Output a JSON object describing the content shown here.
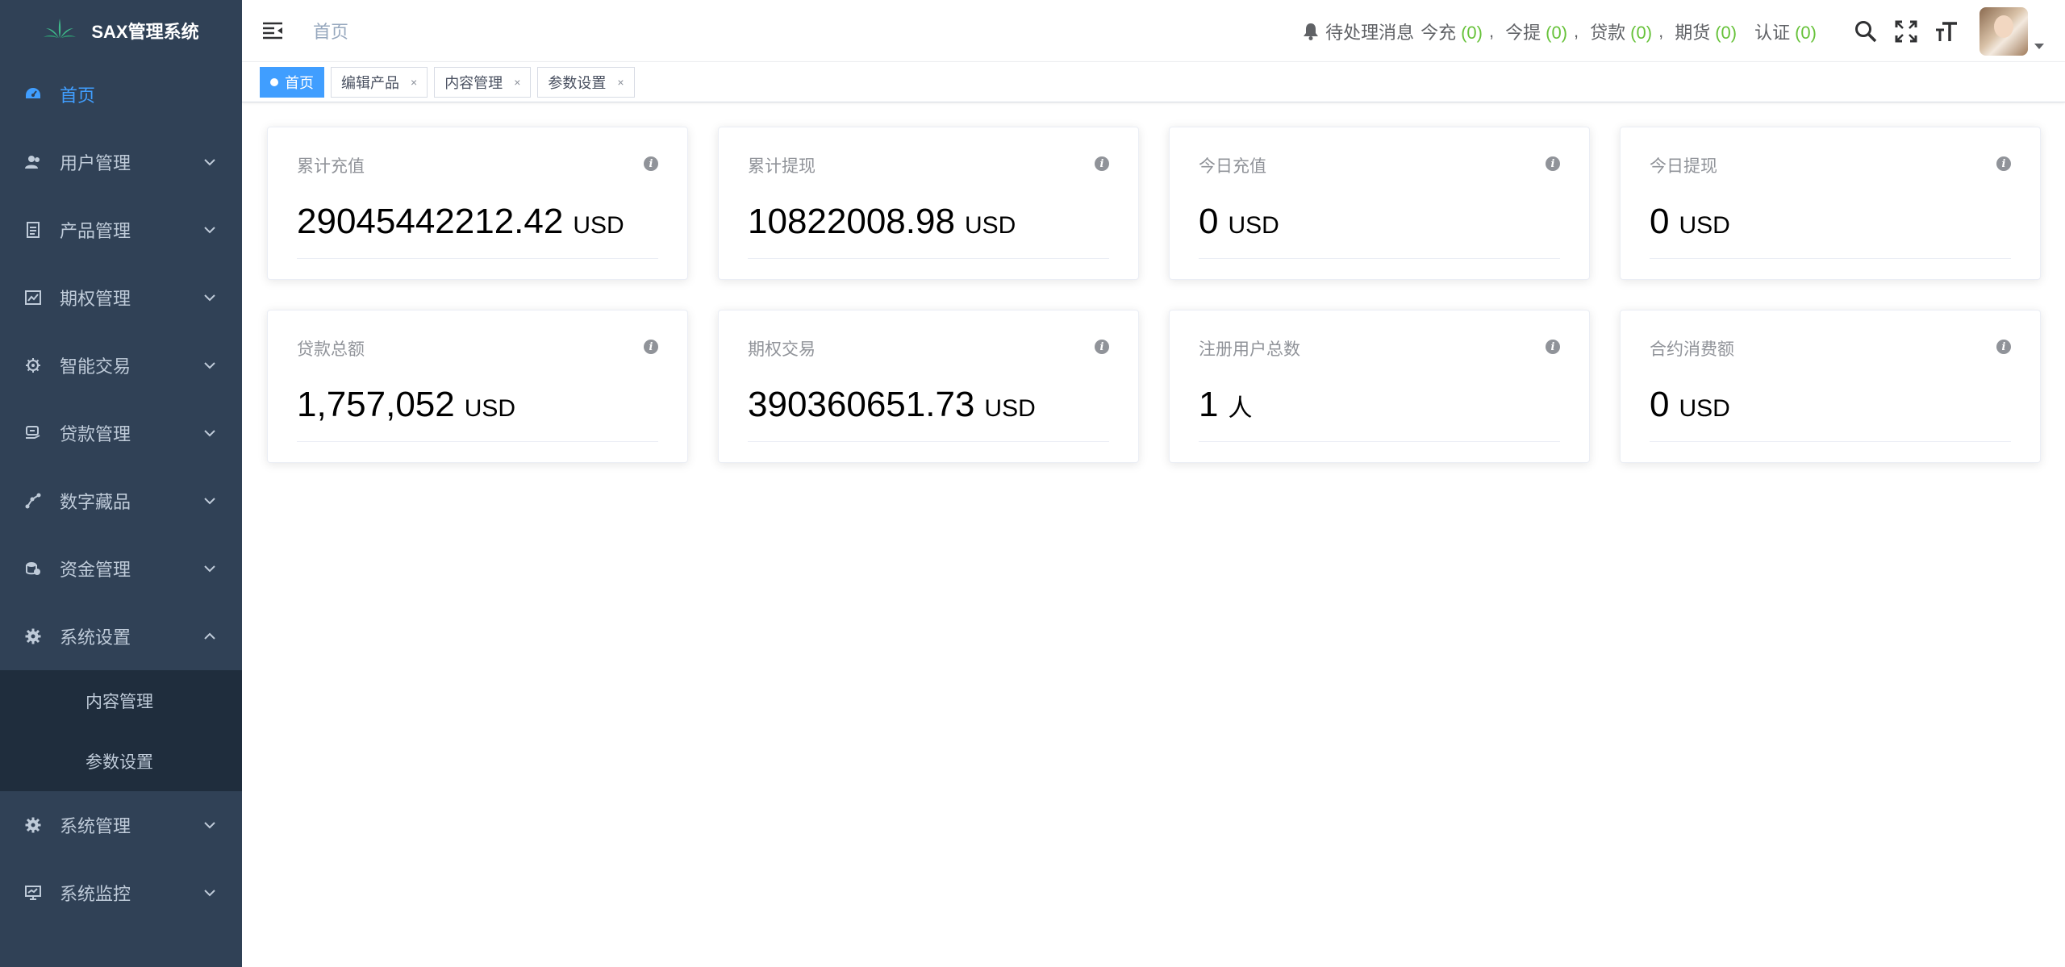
{
  "app": {
    "title": "SAX管理系统"
  },
  "sidebar": {
    "items": [
      {
        "label": "首页",
        "icon": "dashboard-icon"
      },
      {
        "label": "用户管理",
        "icon": "user-icon"
      },
      {
        "label": "产品管理",
        "icon": "document-icon"
      },
      {
        "label": "期权管理",
        "icon": "chart-icon"
      },
      {
        "label": "智能交易",
        "icon": "gear-icon"
      },
      {
        "label": "贷款管理",
        "icon": "loan-icon"
      },
      {
        "label": "数字藏品",
        "icon": "nodes-icon"
      },
      {
        "label": "资金管理",
        "icon": "money-icon"
      },
      {
        "label": "系统设置",
        "icon": "gear-icon"
      },
      {
        "label": "系统管理",
        "icon": "gear-icon"
      },
      {
        "label": "系统监控",
        "icon": "monitor-icon"
      }
    ],
    "submenu": [
      {
        "label": "内容管理"
      },
      {
        "label": "参数设置"
      }
    ]
  },
  "navbar": {
    "breadcrumb": "首页",
    "messages": {
      "prefix": "待处理消息",
      "items": [
        {
          "label": "今充",
          "count": "(0)"
        },
        {
          "label": "今提",
          "count": "(0)"
        },
        {
          "label": "贷款",
          "count": "(0)"
        },
        {
          "label": "期货",
          "count": "(0)"
        },
        {
          "label": "认证",
          "count": "(0)"
        }
      ],
      "separator": ","
    }
  },
  "tags": [
    {
      "label": "首页",
      "active": true
    },
    {
      "label": "编辑产品"
    },
    {
      "label": "内容管理"
    },
    {
      "label": "参数设置"
    }
  ],
  "tag_close": "×",
  "cards": [
    {
      "title": "累计充值",
      "value": "29045442212.42",
      "unit": "USD"
    },
    {
      "title": "累计提现",
      "value": "10822008.98",
      "unit": "USD"
    },
    {
      "title": "今日充值",
      "value": "0",
      "unit": "USD"
    },
    {
      "title": "今日提现",
      "value": "0",
      "unit": "USD"
    },
    {
      "title": "贷款总额",
      "value": "1,757,052",
      "unit": "USD"
    },
    {
      "title": "期权交易",
      "value": "390360651.73",
      "unit": "USD"
    },
    {
      "title": "注册用户总数",
      "value": "1",
      "unit": "人"
    },
    {
      "title": "合约消费额",
      "value": "0",
      "unit": "USD"
    }
  ],
  "card_info_glyph": "i",
  "colors": {
    "sidebar_bg": "#304156",
    "submenu_bg": "#1f2d3d",
    "active": "#409eff",
    "count_green": "#67c23a"
  }
}
